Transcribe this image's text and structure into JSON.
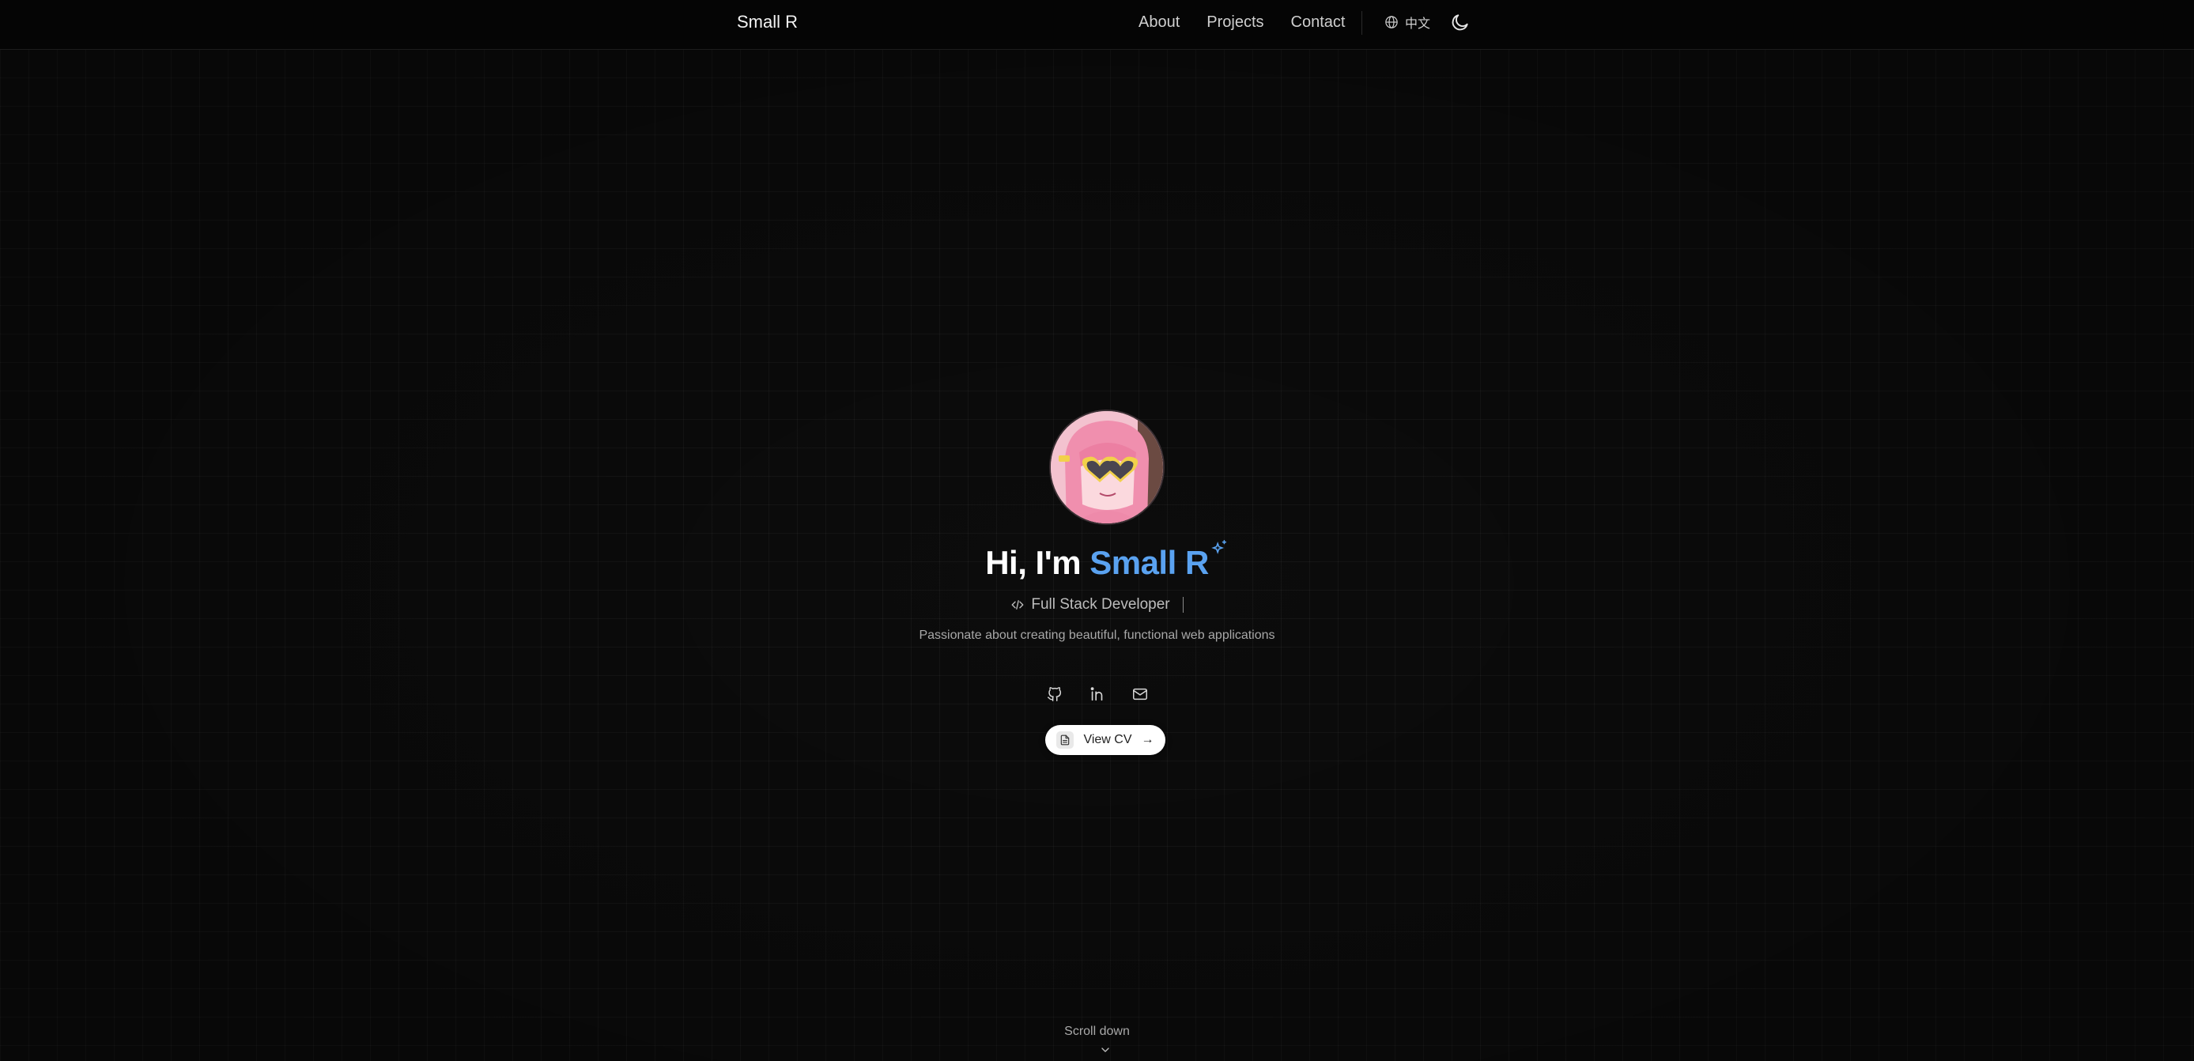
{
  "nav": {
    "brand": "Small R",
    "links": [
      "About",
      "Projects",
      "Contact"
    ],
    "language_label": "中文",
    "icons": {
      "language": "globe-icon",
      "theme": "moon-icon"
    }
  },
  "hero": {
    "greeting": "Hi, I'm",
    "name": "Small R",
    "role": "Full Stack Developer",
    "tagline": "Passionate about creating beautiful, functional web applications",
    "cv_label": "View CV",
    "cv_arrow": "→",
    "socials": [
      "github-icon",
      "linkedin-icon",
      "mail-icon"
    ]
  },
  "scroll": {
    "label": "Scroll down"
  },
  "colors": {
    "background": "#0c0c0c",
    "accent": "#5aa2f0",
    "navbar": "#050505"
  }
}
